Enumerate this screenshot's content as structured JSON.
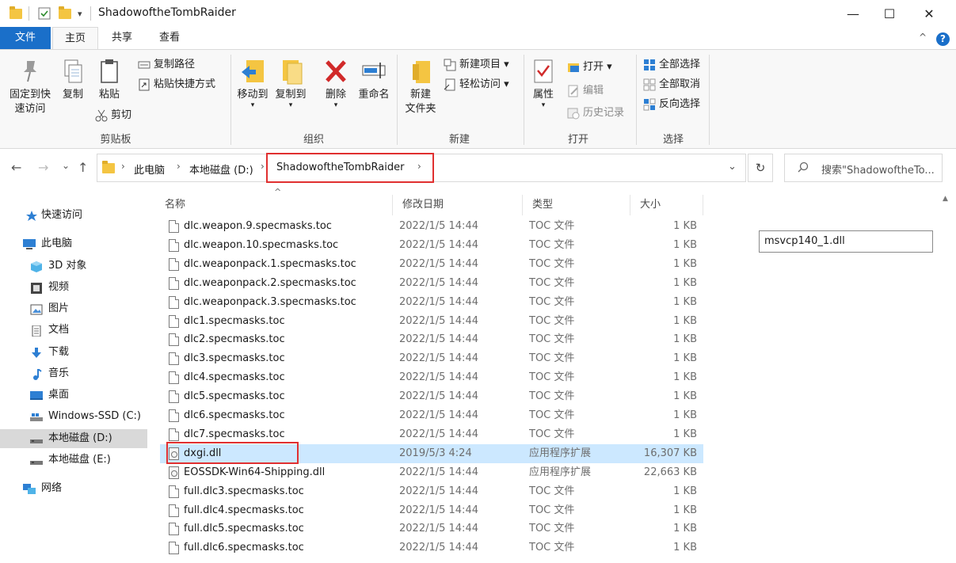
{
  "window": {
    "title": "ShadowoftheTombRaider",
    "minimize": "—",
    "maximize": "☐",
    "close": "✕",
    "quick_access_dropdown": "▾"
  },
  "ribbon_tabs": {
    "file": "文件",
    "home": "主页",
    "share": "共享",
    "view": "查看",
    "collapse": "^",
    "help": "?"
  },
  "ribbon": {
    "clipboard": {
      "pin_quick_access": "固定到快\n速访问",
      "copy": "复制",
      "paste": "粘贴",
      "copy_path": "复制路径",
      "paste_shortcut": "粘贴快捷方式",
      "cut": "剪切",
      "label": "剪贴板"
    },
    "organize": {
      "move_to": "移动到",
      "copy_to": "复制到",
      "delete": "删除",
      "rename": "重命名",
      "label": "组织"
    },
    "new": {
      "new_folder": "新建\n文件夹",
      "new_item": "新建项目 ▾",
      "easy_access": "轻松访问 ▾",
      "label": "新建"
    },
    "open": {
      "properties": "属性",
      "open": "打开 ▾",
      "edit": "编辑",
      "history": "历史记录",
      "label": "打开"
    },
    "select": {
      "select_all": "全部选择",
      "select_none": "全部取消",
      "invert_selection": "反向选择",
      "label": "选择"
    }
  },
  "navigation": {
    "back": "←",
    "forward": "→",
    "recent": "⌄",
    "up": "↑",
    "breadcrumb": [
      "此电脑",
      "本地磁盘 (D:)",
      "ShadowoftheTombRaider"
    ],
    "dropdown": "⌄",
    "refresh": "↻",
    "search_placeholder": "搜索\"ShadowoftheTo..."
  },
  "sidebar": {
    "items": [
      {
        "label": "快速访问",
        "icon": "star-icon"
      },
      {
        "label": "此电脑",
        "icon": "computer-icon"
      },
      {
        "label": "3D 对象",
        "icon": "cube-icon"
      },
      {
        "label": "视频",
        "icon": "video-icon"
      },
      {
        "label": "图片",
        "icon": "picture-icon"
      },
      {
        "label": "文档",
        "icon": "document-icon"
      },
      {
        "label": "下载",
        "icon": "download-icon"
      },
      {
        "label": "音乐",
        "icon": "music-icon"
      },
      {
        "label": "桌面",
        "icon": "desktop-icon"
      },
      {
        "label": "Windows-SSD (C:)",
        "icon": "drive-icon"
      },
      {
        "label": "本地磁盘 (D:)",
        "icon": "drive-icon",
        "selected": true
      },
      {
        "label": "本地磁盘 (E:)",
        "icon": "drive-icon"
      },
      {
        "label": "网络",
        "icon": "network-icon"
      }
    ]
  },
  "file_list": {
    "columns": {
      "name": "名称",
      "modified": "修改日期",
      "type": "类型",
      "size": "大小"
    },
    "rows": [
      {
        "name": "dlc.weapon.9.specmasks.toc",
        "modified": "2022/1/5 14:44",
        "type": "TOC 文件",
        "size": "1 KB"
      },
      {
        "name": "dlc.weapon.10.specmasks.toc",
        "modified": "2022/1/5 14:44",
        "type": "TOC 文件",
        "size": "1 KB"
      },
      {
        "name": "dlc.weaponpack.1.specmasks.toc",
        "modified": "2022/1/5 14:44",
        "type": "TOC 文件",
        "size": "1 KB"
      },
      {
        "name": "dlc.weaponpack.2.specmasks.toc",
        "modified": "2022/1/5 14:44",
        "type": "TOC 文件",
        "size": "1 KB"
      },
      {
        "name": "dlc.weaponpack.3.specmasks.toc",
        "modified": "2022/1/5 14:44",
        "type": "TOC 文件",
        "size": "1 KB"
      },
      {
        "name": "dlc1.specmasks.toc",
        "modified": "2022/1/5 14:44",
        "type": "TOC 文件",
        "size": "1 KB"
      },
      {
        "name": "dlc2.specmasks.toc",
        "modified": "2022/1/5 14:44",
        "type": "TOC 文件",
        "size": "1 KB"
      },
      {
        "name": "dlc3.specmasks.toc",
        "modified": "2022/1/5 14:44",
        "type": "TOC 文件",
        "size": "1 KB"
      },
      {
        "name": "dlc4.specmasks.toc",
        "modified": "2022/1/5 14:44",
        "type": "TOC 文件",
        "size": "1 KB"
      },
      {
        "name": "dlc5.specmasks.toc",
        "modified": "2022/1/5 14:44",
        "type": "TOC 文件",
        "size": "1 KB"
      },
      {
        "name": "dlc6.specmasks.toc",
        "modified": "2022/1/5 14:44",
        "type": "TOC 文件",
        "size": "1 KB"
      },
      {
        "name": "dlc7.specmasks.toc",
        "modified": "2022/1/5 14:44",
        "type": "TOC 文件",
        "size": "1 KB"
      },
      {
        "name": "dxgi.dll",
        "modified": "2019/5/3 4:24",
        "type": "应用程序扩展",
        "size": "16,307 KB",
        "selected": true
      },
      {
        "name": "EOSSDK-Win64-Shipping.dll",
        "modified": "2022/1/5 14:44",
        "type": "应用程序扩展",
        "size": "22,663 KB"
      },
      {
        "name": "full.dlc3.specmasks.toc",
        "modified": "2022/1/5 14:44",
        "type": "TOC 文件",
        "size": "1 KB"
      },
      {
        "name": "full.dlc4.specmasks.toc",
        "modified": "2022/1/5 14:44",
        "type": "TOC 文件",
        "size": "1 KB"
      },
      {
        "name": "full.dlc5.specmasks.toc",
        "modified": "2022/1/5 14:44",
        "type": "TOC 文件",
        "size": "1 KB"
      },
      {
        "name": "full.dlc6.specmasks.toc",
        "modified": "2022/1/5 14:44",
        "type": "TOC 文件",
        "size": "1 KB"
      }
    ]
  },
  "rename_field": {
    "value": "msvcp140_1.dll"
  },
  "colors": {
    "accent": "#1a6fc9",
    "selection": "#cce8ff",
    "highlight": "#e03030",
    "folder": "#f4c542"
  }
}
